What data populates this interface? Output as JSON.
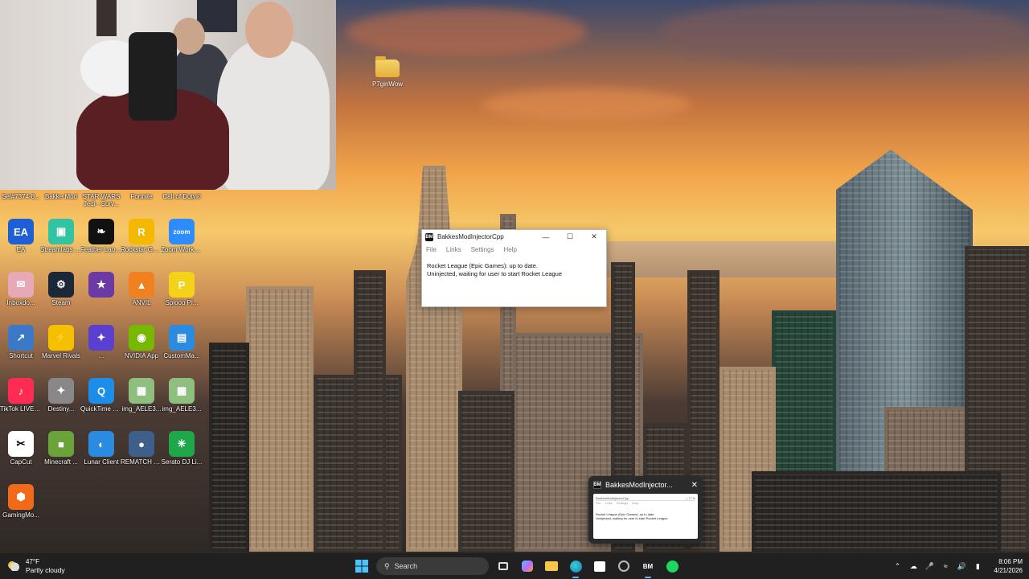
{
  "desktop": {
    "top_row_icons": [
      {
        "label": "Sel#7374-8...",
        "color": "#6d5b4f"
      },
      {
        "label": "Bakke Mod",
        "color": "#4b3b33"
      },
      {
        "label": "STAR WARS Jedi - Surv...",
        "color": "#2d2a28"
      },
      {
        "label": "Fortnite",
        "color": "#3c3c5a"
      },
      {
        "label": "Call of Duty®",
        "color": "#333"
      }
    ],
    "icons": [
      {
        "label": "EA",
        "glyph": "EA",
        "color": "#1e5fd6"
      },
      {
        "label": "Streamlabs Desktop",
        "glyph": "▣",
        "color": "#31c3a2"
      },
      {
        "label": "Feather Launcher",
        "glyph": "❧",
        "color": "#111"
      },
      {
        "label": "Rockstar Games...",
        "glyph": "R",
        "color": "#f5b800"
      },
      {
        "label": "Zoom Workplace",
        "glyph": "zoom",
        "color": "#2d8cff"
      },
      {
        "label": "Inboxdo...",
        "glyph": "✉",
        "color": "#e7a8b8"
      },
      {
        "label": "Steam",
        "glyph": "⚙",
        "color": "#1b2838"
      },
      {
        "label": "",
        "glyph": "★",
        "color": "#6b3aa5"
      },
      {
        "label": "ANVIL",
        "glyph": "▲",
        "color": "#f08020"
      },
      {
        "label": "Sploop Pl...",
        "glyph": "P",
        "color": "#f5d21a"
      },
      {
        "label": "Shortcut",
        "glyph": "↗",
        "color": "#3b78c7"
      },
      {
        "label": "Marvel Rivals",
        "glyph": "⚡",
        "color": "#f5c000"
      },
      {
        "label": "...",
        "glyph": "✦",
        "color": "#5a3fd0"
      },
      {
        "label": "NVIDIA App",
        "glyph": "◉",
        "color": "#76b900"
      },
      {
        "label": "CustomMa...",
        "glyph": "▤",
        "color": "#2b8be0"
      },
      {
        "label": "TikTok LIVE Studio",
        "glyph": "♪",
        "color": "#fe2c55"
      },
      {
        "label": "Destiny...",
        "glyph": "✦",
        "color": "#888"
      },
      {
        "label": "QuickTime Player",
        "glyph": "Q",
        "color": "#1c8de8"
      },
      {
        "label": "img_AELE3...",
        "glyph": "▦",
        "color": "#8fbf7f"
      },
      {
        "label": "img_AELE3...",
        "glyph": "▦",
        "color": "#8fbf7f"
      },
      {
        "label": "CapCut",
        "glyph": "✂",
        "color": "#fff"
      },
      {
        "label": "Minecraft ...",
        "glyph": "■",
        "color": "#6aa33a"
      },
      {
        "label": "Lunar Client",
        "glyph": "◐",
        "color": "#2b8be0"
      },
      {
        "label": "REMATCH BETA TEST",
        "glyph": "●",
        "color": "#3d5f8a"
      },
      {
        "label": "Serato DJ Li...",
        "glyph": "✳",
        "color": "#1ea84a"
      },
      {
        "label": "GamingMo...",
        "glyph": "⬢",
        "color": "#f06a1a"
      }
    ],
    "folder": {
      "label": "P7ginWow"
    }
  },
  "injector_window": {
    "title": "BakkesModInjectorCpp",
    "app_icon": "BM",
    "controls": {
      "minimize": "—",
      "maximize": "☐",
      "close": "✕"
    },
    "menu": [
      "File",
      "Links",
      "Settings",
      "Help"
    ],
    "status_line1": "Rocket League (Epic Games): up to date.",
    "status_line2": "Uninjected, waiting for user to start Rocket League"
  },
  "taskbar_preview": {
    "title": "BakkesModInjector...",
    "app_icon": "BM",
    "close": "✕",
    "thumb_title": "BakkesModInjectorCpp",
    "thumb_menu": [
      "File",
      "Links",
      "Settings",
      "Help"
    ],
    "thumb_line1": "Rocket League (Epic Games): up to date.",
    "thumb_line2": "Uninjected, waiting for user to start Rocket League"
  },
  "taskbar": {
    "weather_temp": "47°F",
    "weather_condition": "Partly cloudy",
    "search_placeholder": "Search",
    "time": "8:06 PM",
    "date": "4/21/2026"
  }
}
